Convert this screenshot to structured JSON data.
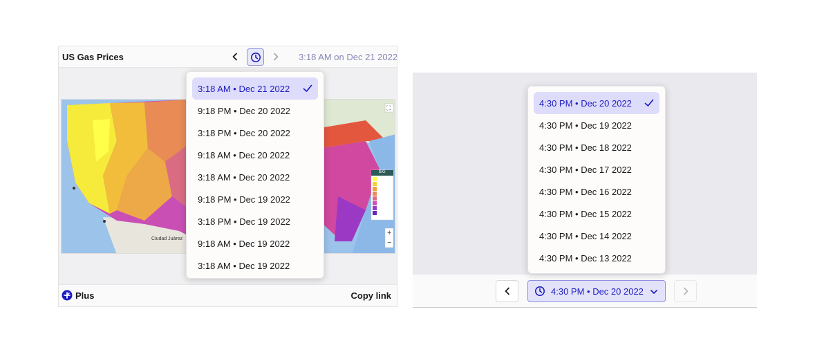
{
  "left": {
    "title": "US Gas Prices",
    "timestamp": "3:18 AM on Dec 21 2022",
    "map_city_label": "Ciudad Juárez",
    "legend_title": "$/G",
    "footer": {
      "plus_label": "Plus",
      "copy_link_label": "Copy link"
    },
    "dropdown": [
      {
        "label": "3:18 AM • Dec 21 2022",
        "selected": true
      },
      {
        "label": "9:18 PM • Dec 20 2022",
        "selected": false
      },
      {
        "label": "3:18 PM • Dec 20 2022",
        "selected": false
      },
      {
        "label": "9:18 AM • Dec 20 2022",
        "selected": false
      },
      {
        "label": "3:18 AM • Dec 20 2022",
        "selected": false
      },
      {
        "label": "9:18 PM • Dec 19 2022",
        "selected": false
      },
      {
        "label": "3:18 PM • Dec 19 2022",
        "selected": false
      },
      {
        "label": "9:18 AM • Dec 19 2022",
        "selected": false
      },
      {
        "label": "3:18 AM • Dec 19 2022",
        "selected": false
      }
    ]
  },
  "right": {
    "selected_label": "4:30 PM • Dec 20 2022",
    "dropdown": [
      {
        "label": "4:30 PM • Dec 20 2022",
        "selected": true
      },
      {
        "label": "4:30 PM • Dec 19 2022",
        "selected": false
      },
      {
        "label": "4:30 PM • Dec 18 2022",
        "selected": false
      },
      {
        "label": "4:30 PM • Dec 17 2022",
        "selected": false
      },
      {
        "label": "4:30 PM • Dec 16 2022",
        "selected": false
      },
      {
        "label": "4:30 PM • Dec 15 2022",
        "selected": false
      },
      {
        "label": "4:30 PM • Dec 14 2022",
        "selected": false
      },
      {
        "label": "4:30 PM • Dec 13 2022",
        "selected": false
      }
    ]
  },
  "colors": {
    "accent": "#1d1dbf",
    "selected_bg": "#dedcfb",
    "accent_border": "#8f8fe0",
    "timestamp_text": "#8888b8"
  },
  "icons": {
    "prev": "chevron-left-icon",
    "next": "chevron-right-icon",
    "clock": "clock-icon",
    "check": "check-icon",
    "expand": "chevron-down-icon",
    "plus": "plus-badge-icon",
    "fullscreen": "fullscreen-icon",
    "zoom_in": "zoom-in-icon",
    "zoom_out": "zoom-out-icon"
  }
}
